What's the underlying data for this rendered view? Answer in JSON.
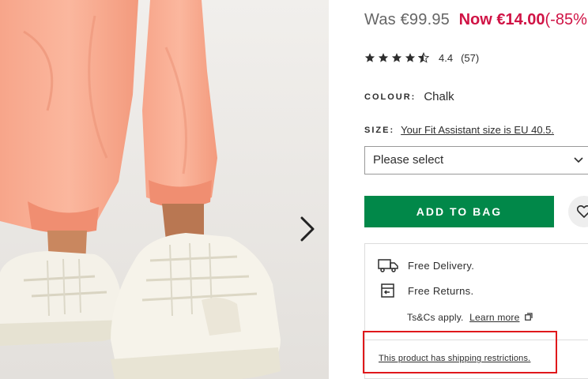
{
  "gallery": {
    "image_alt": "Person wearing peach joggers and white Reebok sneakers",
    "next_icon": "chevron-right-icon"
  },
  "price": {
    "was": "Was €99.95",
    "now": "Now €14.00",
    "discount": "(-85%"
  },
  "rating": {
    "stars": 4.5,
    "value": "4.4",
    "count": "(57)"
  },
  "colour": {
    "label": "COLOUR:",
    "value": "Chalk"
  },
  "size": {
    "label": "SIZE:",
    "fit_link": "Your Fit Assistant size is EU 40.5.",
    "select_value": "Please select"
  },
  "actions": {
    "add_to_bag": "ADD TO BAG",
    "wishlist_icon": "heart-icon"
  },
  "delivery": {
    "free_delivery": "Free Delivery.",
    "free_returns": "Free Returns.",
    "tcs": "Ts&Cs apply.",
    "learn_more": "Learn more",
    "restrictions": "This product has shipping restrictions."
  },
  "colors": {
    "sale": "#d01345",
    "add_to_bag": "#018849",
    "highlight": "#e0181b"
  }
}
